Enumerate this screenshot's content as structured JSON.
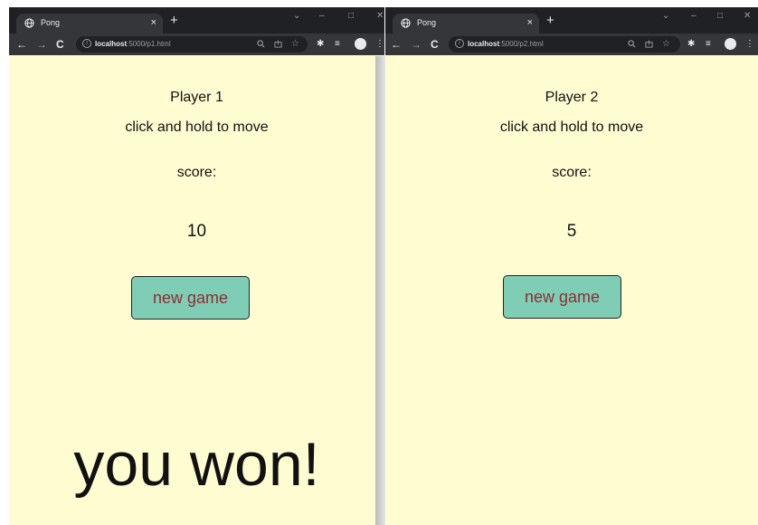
{
  "windows": [
    {
      "tab": {
        "title": "Pong",
        "close": "×"
      },
      "new_tab": "+",
      "window_controls": {
        "minimize": "–",
        "maximize": "□",
        "close": "✕",
        "tab_search": "⌄"
      },
      "nav": {
        "back": "←",
        "forward": "→",
        "reload": "C"
      },
      "url": {
        "host": "localhost",
        "path": ":5000/p1.html"
      },
      "page": {
        "player": "Player 1",
        "hint": "click and hold to move",
        "score_label": "score:",
        "score_value": "10",
        "new_game_label": "new game",
        "result": "you won!"
      }
    },
    {
      "tab": {
        "title": "Pong",
        "close": "×"
      },
      "new_tab": "+",
      "window_controls": {
        "minimize": "–",
        "maximize": "□",
        "close": "✕",
        "tab_search": "⌄"
      },
      "nav": {
        "back": "←",
        "forward": "→",
        "reload": "C"
      },
      "url": {
        "host": "localhost",
        "path": ":5000/p2.html"
      },
      "page": {
        "player": "Player 2",
        "hint": "click and hold to move",
        "score_label": "score:",
        "score_value": "5",
        "new_game_label": "new game",
        "result": ""
      }
    }
  ],
  "colors": {
    "page_background": "#fffcd1",
    "button_fill": "#7fcdb5",
    "button_text": "#8b2f36",
    "chrome_dark": "#202124",
    "chrome_toolbar": "#35363a"
  },
  "icons": [
    "globe-icon",
    "close-icon",
    "plus-icon",
    "back-icon",
    "forward-icon",
    "reload-icon",
    "info-icon",
    "zoom-icon",
    "share-icon",
    "star-icon",
    "extensions-icon",
    "reading-list-icon",
    "profile-avatar-icon",
    "kebab-menu-icon"
  ]
}
